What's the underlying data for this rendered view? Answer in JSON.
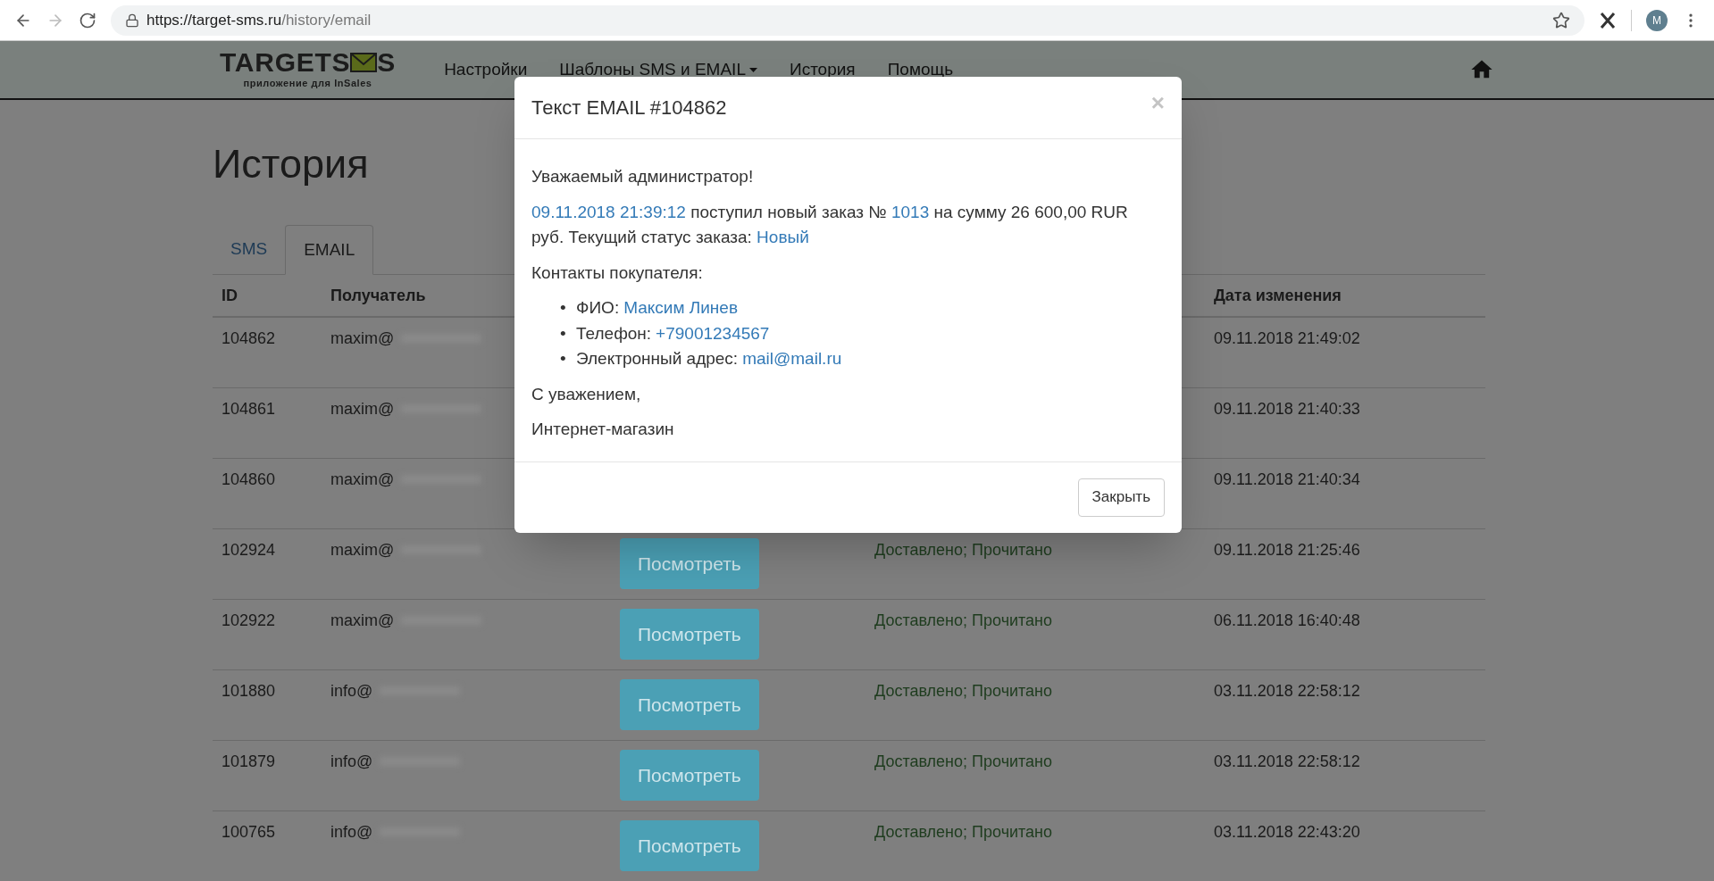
{
  "browser": {
    "url_host": "https://target-sms.ru",
    "url_path": "/history/email",
    "avatar": "M"
  },
  "navbar": {
    "logo_left": "TARGETS",
    "logo_right": "S",
    "logo_tagline": "приложение для InSales",
    "items": [
      {
        "label": "Настройки",
        "dropdown": false
      },
      {
        "label": "Шаблоны SMS и EMAIL",
        "dropdown": true
      },
      {
        "label": "История",
        "dropdown": false
      },
      {
        "label": "Помощь",
        "dropdown": false
      }
    ]
  },
  "page_title": "История",
  "tabs": [
    {
      "label": "SMS",
      "selected": false
    },
    {
      "label": "EMAIL",
      "selected": true
    }
  ],
  "table": {
    "columns": [
      "ID",
      "Получатель",
      "Дата изменения"
    ],
    "rows": [
      {
        "id": "104862",
        "recipient": "maxim@",
        "date": "09.11.2018 21:49:02"
      },
      {
        "id": "104861",
        "recipient": "maxim@",
        "date": "09.11.2018 21:40:33"
      },
      {
        "id": "104860",
        "recipient": "maxim@",
        "date": "09.11.2018 21:40:34"
      },
      {
        "id": "102924",
        "recipient": "maxim@",
        "action": "Посмотреть",
        "status": "Доставлено; Прочитано",
        "date": "09.11.2018 21:25:46"
      },
      {
        "id": "102922",
        "recipient": "maxim@",
        "action": "Посмотреть",
        "status": "Доставлено; Прочитано",
        "date": "06.11.2018 16:40:48"
      },
      {
        "id": "101880",
        "recipient": "info@",
        "action": "Посмотреть",
        "status": "Доставлено; Прочитано",
        "date": "03.11.2018 22:58:12"
      },
      {
        "id": "101879",
        "recipient": "info@",
        "action": "Посмотреть",
        "status": "Доставлено; Прочитано",
        "date": "03.11.2018 22:58:12"
      },
      {
        "id": "100765",
        "recipient": "info@",
        "action": "Посмотреть",
        "status": "Доставлено; Прочитано",
        "date": "03.11.2018 22:43:20"
      }
    ]
  },
  "modal": {
    "title": "Текст EMAIL #104862",
    "close_glyph": "×",
    "greeting": "Уважаемый администратор!",
    "order_line": [
      {
        "text": "09.11.2018 21:39:12",
        "link": true
      },
      {
        "text": " поступил новый заказ № ",
        "link": false
      },
      {
        "text": "1013",
        "link": true
      },
      {
        "text": " на сумму 26 600,00 RUR руб. Текущий статус заказа: ",
        "link": false
      },
      {
        "text": "Новый",
        "link": true
      }
    ],
    "contacts_heading": "Контакты покупателя:",
    "contacts": [
      {
        "bullet": "•",
        "label": "ФИО:",
        "value": "Максим Линев"
      },
      {
        "bullet": "•",
        "label": "Телефон:",
        "value": "+79001234567"
      },
      {
        "bullet": "•",
        "label": "Электронный адрес:",
        "value": "mail@mail.ru"
      }
    ],
    "closing": [
      "С уважением,",
      "Интернет-магазин"
    ],
    "button": "Закрыть"
  }
}
